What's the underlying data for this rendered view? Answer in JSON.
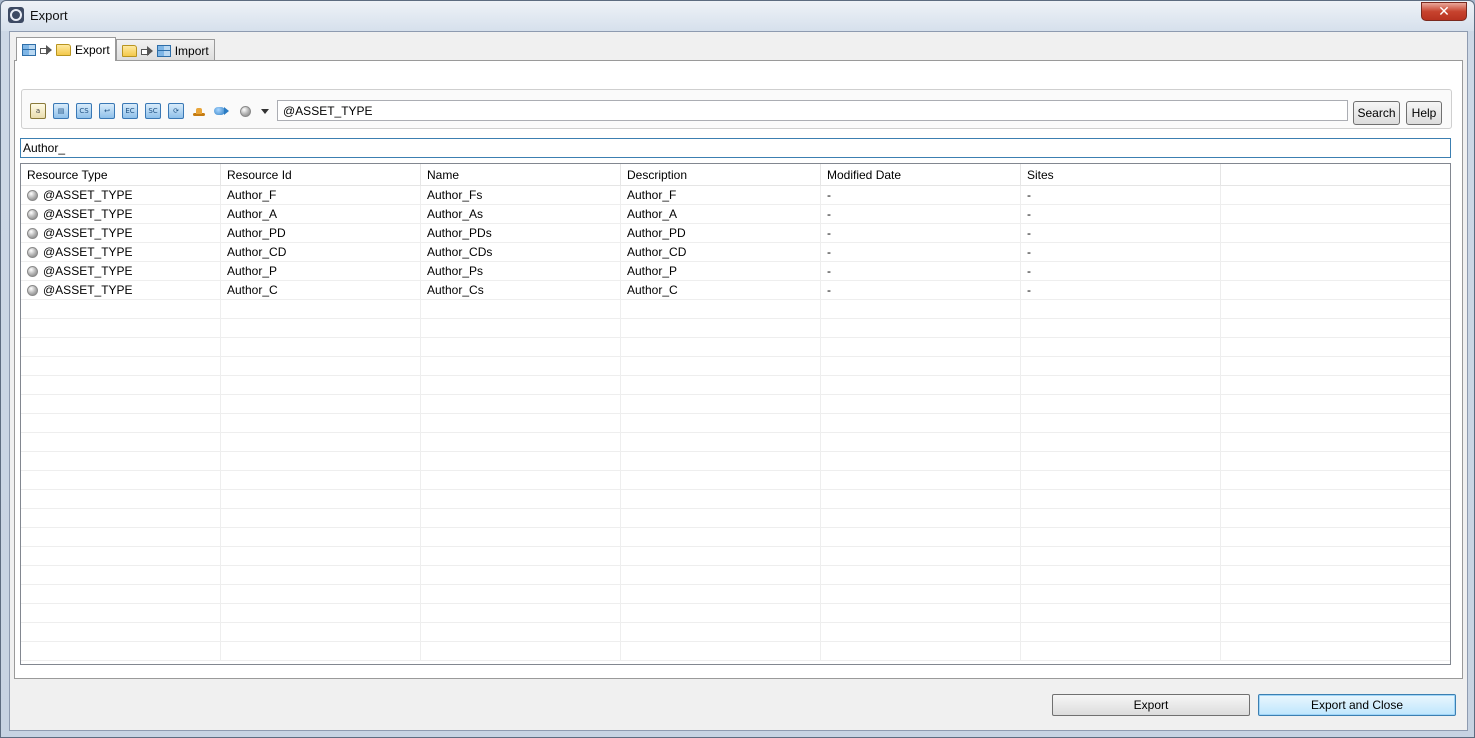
{
  "window": {
    "title": "Export",
    "close_label": "✕"
  },
  "tabs": [
    {
      "label": "Export",
      "active": true,
      "icons": [
        "grid-icon",
        "arrow-right-icon",
        "folder-icon"
      ]
    },
    {
      "label": "Import",
      "active": false,
      "icons": [
        "folder-icon",
        "arrow-right-icon",
        "grid-icon"
      ]
    }
  ],
  "toolbar": {
    "icons": [
      {
        "name": "document-icon",
        "glyph": "a"
      },
      {
        "name": "list-icon",
        "glyph": "▤"
      },
      {
        "name": "cs-icon",
        "glyph": "CS"
      },
      {
        "name": "link-icon",
        "glyph": "↩"
      },
      {
        "name": "ec-icon",
        "glyph": "EC"
      },
      {
        "name": "sc-icon",
        "glyph": "SC"
      },
      {
        "name": "refresh-icon",
        "glyph": "⟳"
      },
      {
        "name": "hat-icon",
        "glyph": ""
      },
      {
        "name": "pill-icon",
        "glyph": ""
      },
      {
        "name": "gray-ball-icon",
        "glyph": ""
      }
    ],
    "type_value": "@ASSET_TYPE",
    "search_label": "Search",
    "help_label": "Help"
  },
  "filter": {
    "value": "Author_"
  },
  "table": {
    "columns": [
      "Resource Type",
      "Resource Id",
      "Name",
      "Description",
      "Modified Date",
      "Sites"
    ],
    "rows": [
      {
        "type": "@ASSET_TYPE",
        "id": "Author_F",
        "name": "Author_Fs",
        "description": "Author_F",
        "modified": "-",
        "sites": "-"
      },
      {
        "type": "@ASSET_TYPE",
        "id": "Author_A",
        "name": "Author_As",
        "description": "Author_A",
        "modified": "-",
        "sites": "-"
      },
      {
        "type": "@ASSET_TYPE",
        "id": "Author_PD",
        "name": "Author_PDs",
        "description": "Author_PD",
        "modified": "-",
        "sites": "-"
      },
      {
        "type": "@ASSET_TYPE",
        "id": "Author_CD",
        "name": "Author_CDs",
        "description": "Author_CD",
        "modified": "-",
        "sites": "-"
      },
      {
        "type": "@ASSET_TYPE",
        "id": "Author_P",
        "name": "Author_Ps",
        "description": "Author_P",
        "modified": "-",
        "sites": "-"
      },
      {
        "type": "@ASSET_TYPE",
        "id": "Author_C",
        "name": "Author_Cs",
        "description": "Author_C",
        "modified": "-",
        "sites": "-"
      }
    ]
  },
  "footer": {
    "export_label": "Export",
    "export_close_label": "Export and Close"
  }
}
